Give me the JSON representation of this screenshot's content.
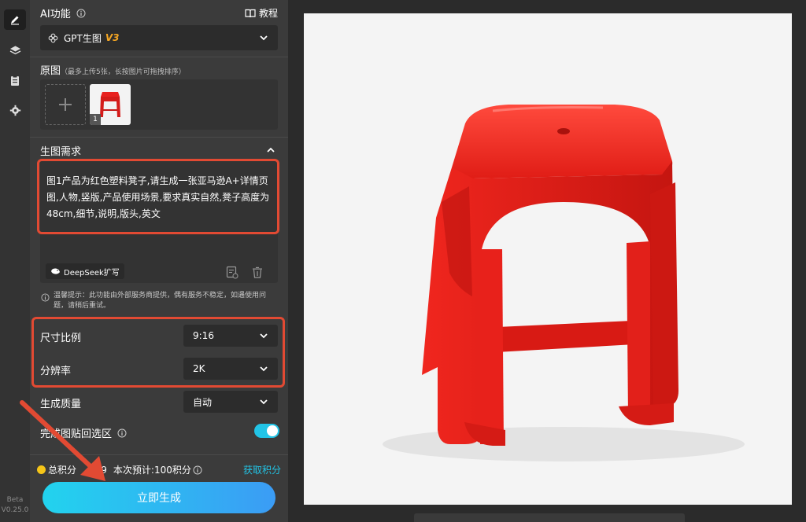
{
  "sidebar": {
    "version_tag": "Beta",
    "version": "V0.25.0"
  },
  "panel": {
    "ai_title": "AI功能",
    "tutorial_label": "教程",
    "model": {
      "name": "GPT生图",
      "badge": "V3"
    },
    "source": {
      "title": "原图",
      "hint": "（最多上传5张，长按图片可拖拽排序）",
      "thumb_index": "1"
    },
    "prompt": {
      "title": "生图需求",
      "text": "图1产品为红色塑料凳子,请生成一张亚马逊A+详情页图,人物,竖版,产品使用场景,要求真实自然,凳子高度为48cm,细节,说明,版头,英文",
      "deepseek_label": "DeepSeek扩写"
    },
    "notice": "温馨提示：此功能由外部服务商提供，偶有服务不稳定，如遇使用问题，请稍后重试。",
    "settings": [
      {
        "label": "尺寸比例",
        "value": "9:16"
      },
      {
        "label": "分辨率",
        "value": "2K"
      },
      {
        "label": "生成质量",
        "value": "自动"
      }
    ],
    "paste_back": {
      "label": "完成图贴回选区",
      "enabled": true
    },
    "credits": {
      "total_label": "总积分",
      "total_value": "939",
      "estimate": "本次预计:100积分",
      "get_label": "获取积分"
    },
    "generate_label": "立即生成"
  },
  "colors": {
    "accent": "#22d3ee",
    "highlight": "#e24a33",
    "stool": "#e8211f"
  }
}
